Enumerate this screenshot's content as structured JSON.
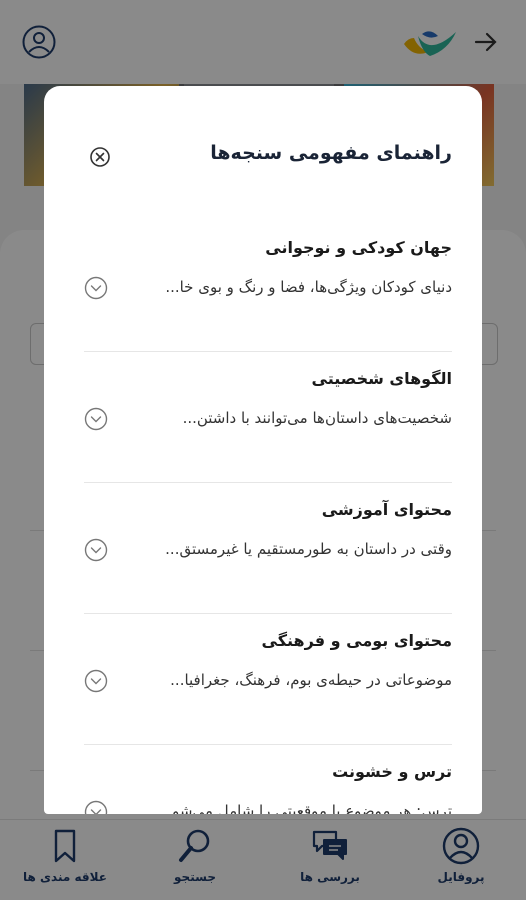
{
  "bottom_nav": {
    "items": [
      {
        "label": "علاقه مندی ها",
        "icon": "bookmark-icon"
      },
      {
        "label": "جستجو",
        "icon": "search-icon"
      },
      {
        "label": "بررسی ها",
        "icon": "chat-bubbles-icon"
      },
      {
        "label": "پروفایل",
        "icon": "user-circle-icon"
      }
    ]
  },
  "modal": {
    "title": "راهنمای مفهومی سنجه‌ها",
    "close_icon": "close-circle-icon",
    "items": [
      {
        "title": "جهان کودکی و نوجوانی",
        "desc": "دنیای کودکان ویژگی‌ها، فضا و رنگ و بوی خا...",
        "toggle_icon": "chevron-down-circle-icon"
      },
      {
        "title": "الگوهای شخصیتی",
        "desc": "شخصیت‌های داستان‌ها می‌توانند با داشتن...",
        "toggle_icon": "chevron-down-circle-icon"
      },
      {
        "title": "محتوای آموزشی",
        "desc": "وقتی در داستان به طورمستقیم یا غیرمستق...",
        "toggle_icon": "chevron-down-circle-icon"
      },
      {
        "title": "محتوای بومی و فرهنگی",
        "desc": "موضوعاتی در حیطه‌ی بوم، فرهنگ، جغرافیا...",
        "toggle_icon": "chevron-down-circle-icon"
      },
      {
        "title": "ترس و خشونت",
        "desc": "ترس: هر موضوع یا موقعیتی را شامل می‌شو...",
        "toggle_icon": "chevron-down-circle-icon"
      }
    ]
  },
  "colors": {
    "accent": "#1f3b6b",
    "overlay": "rgba(0,0,0,0.46)"
  }
}
